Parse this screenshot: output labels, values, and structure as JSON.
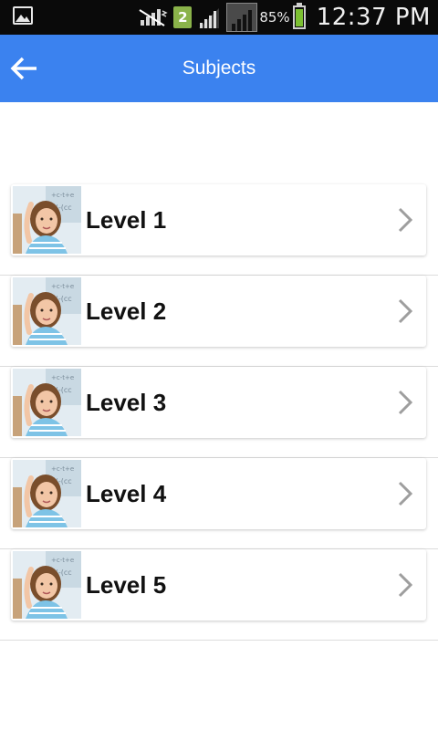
{
  "status_bar": {
    "sim_slot": "2",
    "battery_percent": "85%",
    "battery_level": 0.85,
    "time": "12:37 PM",
    "icons": [
      "gallery-notification-icon",
      "no-signal-icon",
      "sim-icon",
      "signal-icon",
      "signal-icon",
      "battery-icon"
    ]
  },
  "app_bar": {
    "title": "Subjects",
    "back_icon": "back-arrow-icon",
    "color": "#3b82ef"
  },
  "levels": [
    {
      "label": "Level 1"
    },
    {
      "label": "Level 2"
    },
    {
      "label": "Level 3"
    },
    {
      "label": "Level 4"
    },
    {
      "label": "Level 5"
    }
  ]
}
